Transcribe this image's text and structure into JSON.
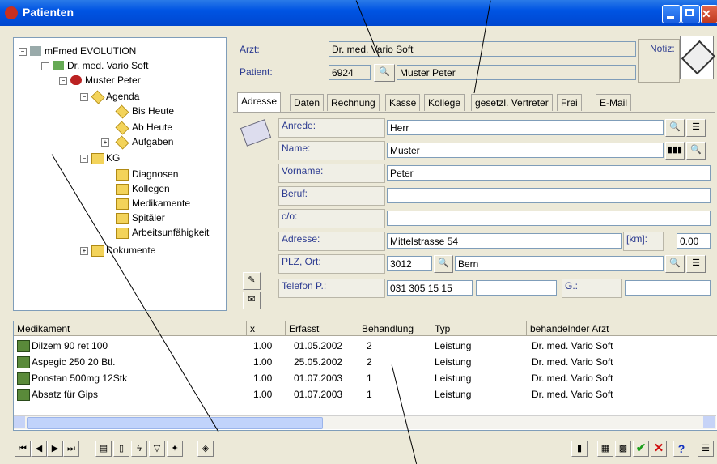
{
  "window": {
    "title": "Patienten"
  },
  "tree": {
    "items": [
      {
        "label": "mFmed EVOLUTION"
      },
      {
        "label": "Dr. med. Vario Soft"
      },
      {
        "label": "Muster Peter"
      },
      {
        "label": "Agenda"
      },
      {
        "label": "Bis Heute"
      },
      {
        "label": "Ab Heute"
      },
      {
        "label": "Aufgaben"
      },
      {
        "label": "KG"
      },
      {
        "label": "Diagnosen"
      },
      {
        "label": "Kollegen"
      },
      {
        "label": "Medikamente"
      },
      {
        "label": "Spitäler"
      },
      {
        "label": "Arbeitsunfähigkeit"
      },
      {
        "label": "Dokumente"
      }
    ]
  },
  "header": {
    "arzt_label": "Arzt:",
    "arzt_value": "Dr. med. Vario Soft",
    "patient_label": "Patient:",
    "patient_id": "6924",
    "patient_name": "Muster Peter",
    "notiz_label": "Notiz:"
  },
  "tabs": [
    "Adresse",
    "Daten",
    "Rechnung",
    "Kasse",
    "Kollege",
    "gesetzl. Vertreter",
    "Frei",
    "E-Mail"
  ],
  "form": {
    "anrede_label": "Anrede:",
    "anrede": "Herr",
    "name_label": "Name:",
    "name": "Muster",
    "vorname_label": "Vorname:",
    "vorname": "Peter",
    "beruf_label": "Beruf:",
    "beruf": "",
    "co_label": "c/o:",
    "co": "",
    "adresse_label": "Adresse:",
    "adresse": "Mittelstrasse 54",
    "km_label": "[km]:",
    "km": "0.00",
    "plz_label": "PLZ, Ort:",
    "plz": "3012",
    "ort": "Bern",
    "telefon_label": "Telefon P.:",
    "telefon": "031 305 15 15",
    "g_label": "G.:"
  },
  "grid": {
    "headers": [
      "Medikament",
      "x",
      "Erfasst",
      "Behandlung",
      "Typ",
      "behandelnder Arzt"
    ],
    "rows": [
      [
        "Dilzem 90 ret 100",
        "1.00",
        "01.05.2002",
        "2",
        "Leistung",
        "Dr. med. Vario Soft"
      ],
      [
        "Aspegic 250 20 Btl.",
        "1.00",
        "25.05.2002",
        "2",
        "Leistung",
        "Dr. med. Vario Soft"
      ],
      [
        "Ponstan 500mg 12Stk",
        "1.00",
        "01.07.2003",
        "1",
        "Leistung",
        "Dr. med. Vario Soft"
      ],
      [
        "Absatz für Gips",
        "1.00",
        "01.07.2003",
        "1",
        "Leistung",
        "Dr. med. Vario Soft"
      ]
    ]
  },
  "colors": {
    "titlebar": "#0054e3",
    "accept": "#1a9e1a",
    "cancel": "#d01010",
    "help": "#1030c0"
  }
}
